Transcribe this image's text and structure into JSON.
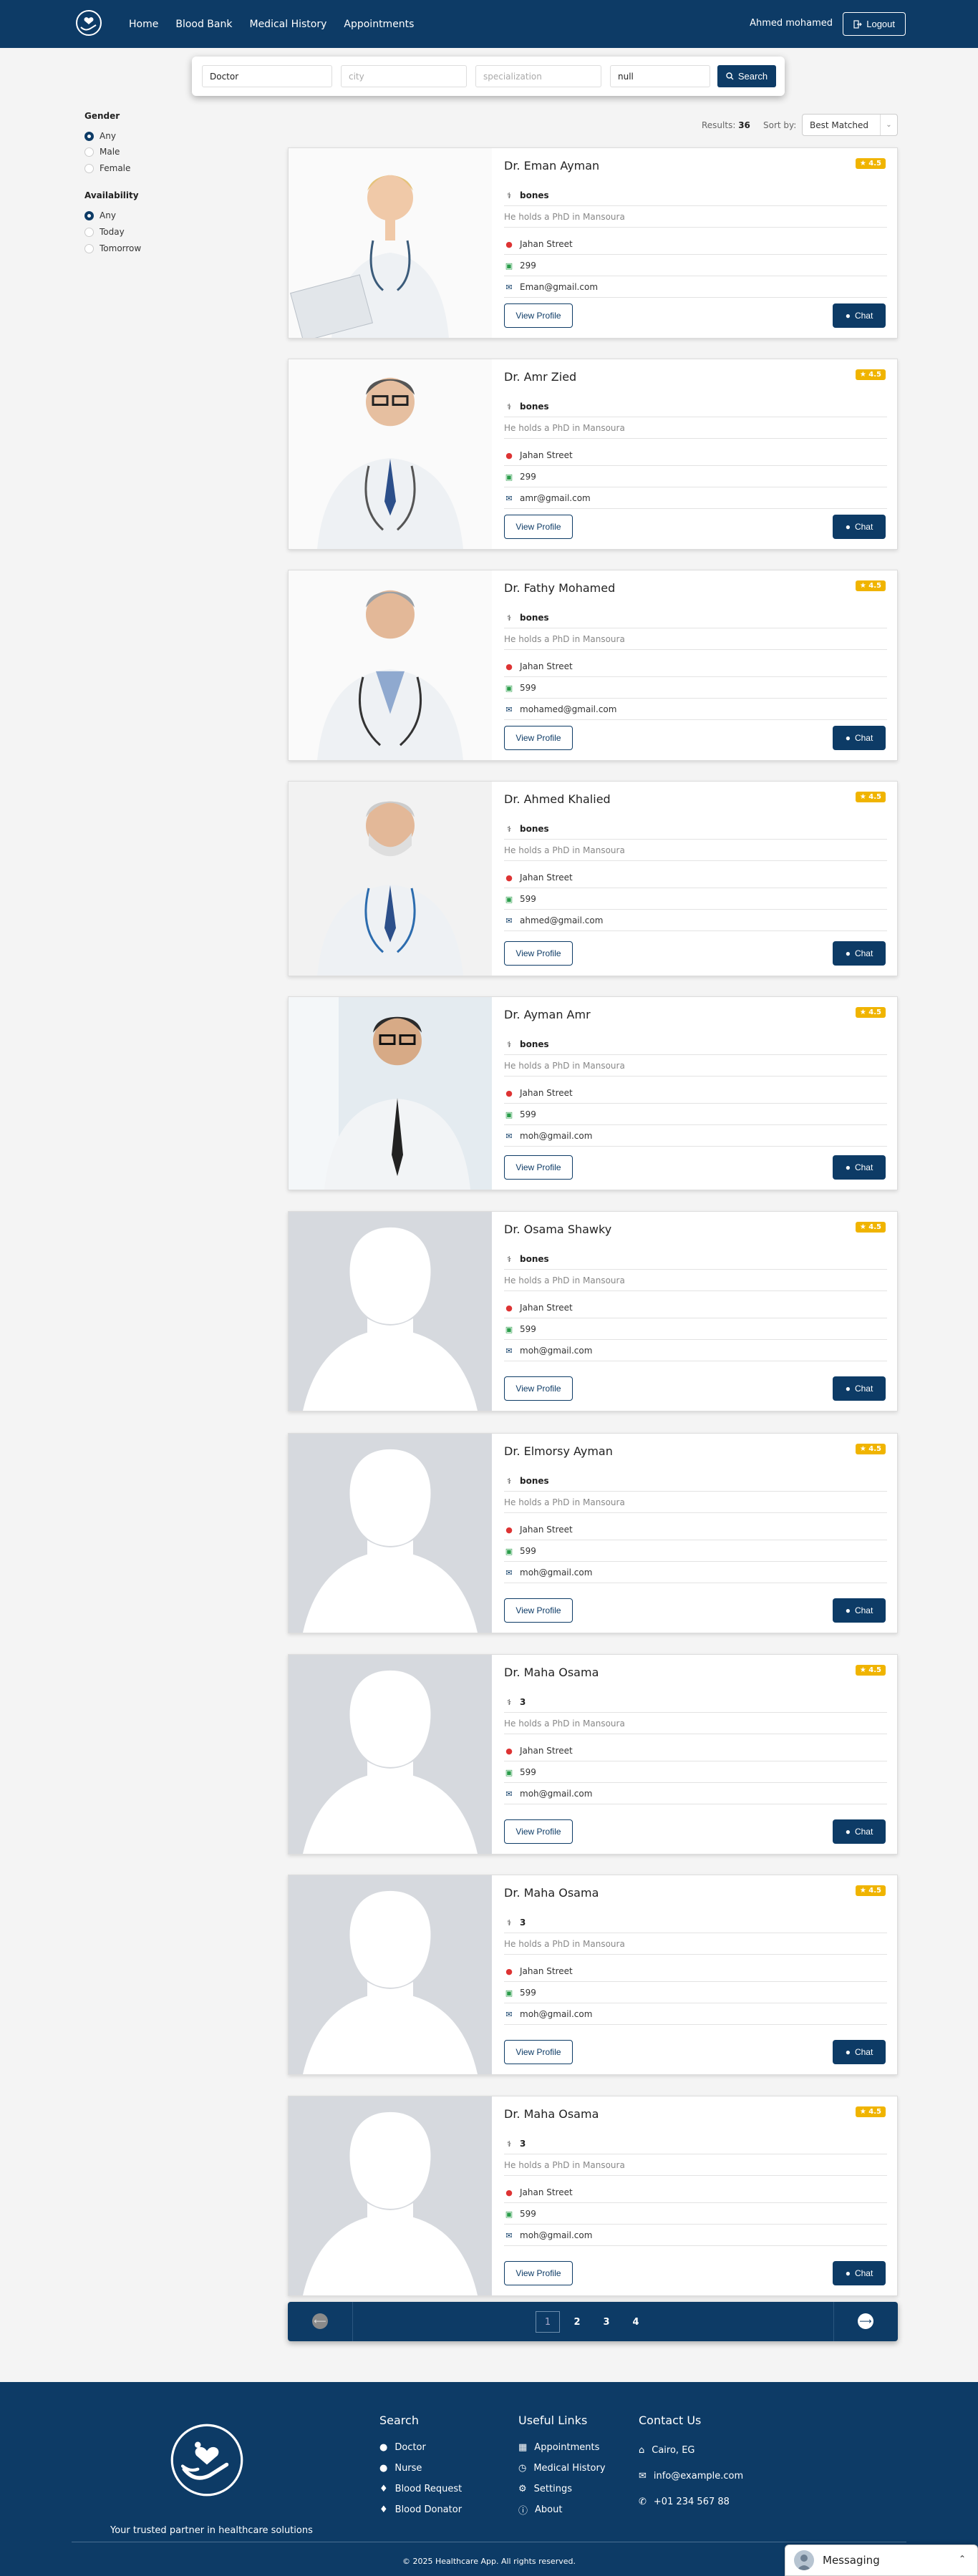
{
  "nav": {
    "links": [
      "Home",
      "Blood Bank",
      "Medical History",
      "Appointments"
    ],
    "user": "Ahmed mohamed",
    "logout": "Logout"
  },
  "search": {
    "profession_value": "Doctor",
    "city_placeholder": "city",
    "specialization_placeholder": "specialization",
    "name_value": "null",
    "button": "Search"
  },
  "filters": {
    "gender_title": "Gender",
    "gender_options": [
      "Any",
      "Male",
      "Female"
    ],
    "gender_selected": "Any",
    "availability_title": "Availability",
    "availability_options": [
      "Any",
      "Today",
      "Tomorrow"
    ],
    "availability_selected": "Any"
  },
  "results": {
    "label": "Results:",
    "count": "36",
    "sort_label": "Sort by:",
    "sort_value": "Best Matched"
  },
  "doctors": [
    {
      "name": "Dr. Eman Ayman",
      "rating": "4.5",
      "specialty": "bones",
      "about": "He holds a PhD in Mansoura",
      "address": "Jahan Street",
      "price": "299",
      "email": "Eman@gmail.com",
      "view": "View Profile",
      "chat": "Chat",
      "photo": "female-doctor-clipboard"
    },
    {
      "name": "Dr. Amr Zied",
      "rating": "4.5",
      "specialty": "bones",
      "about": "He holds a PhD in Mansoura",
      "address": "Jahan Street",
      "price": "299",
      "email": "amr@gmail.com",
      "view": "View Profile",
      "chat": "Chat",
      "photo": "male-doctor-glasses"
    },
    {
      "name": "Dr. Fathy Mohamed",
      "rating": "4.5",
      "specialty": "bones",
      "about": "He holds a PhD in Mansoura",
      "address": "Jahan Street",
      "price": "599",
      "email": "mohamed@gmail.com",
      "view": "View Profile",
      "chat": "Chat",
      "photo": "senior-male-doctor"
    },
    {
      "name": "Dr. Ahmed Khalied",
      "rating": "4.5",
      "specialty": "bones",
      "about": "He holds a PhD in Mansoura",
      "address": "Jahan Street",
      "price": "599",
      "email": "ahmed@gmail.com",
      "view": "View Profile",
      "chat": "Chat",
      "photo": "bearded-male-doctor"
    },
    {
      "name": "Dr. Ayman Amr",
      "rating": "4.5",
      "specialty": "bones",
      "about": "He holds a PhD in Mansoura",
      "address": "Jahan Street",
      "price": "599",
      "email": "moh@gmail.com",
      "view": "View Profile",
      "chat": "Chat",
      "photo": "young-male-doctor"
    },
    {
      "name": "Dr. Osama Shawky",
      "rating": "4.5",
      "specialty": "bones",
      "about": "He holds a PhD in Mansoura",
      "address": "Jahan Street",
      "price": "599",
      "email": "moh@gmail.com",
      "view": "View Profile",
      "chat": "Chat",
      "photo": "placeholder"
    },
    {
      "name": "Dr. Elmorsy Ayman",
      "rating": "4.5",
      "specialty": "bones",
      "about": "He holds a PhD in Mansoura",
      "address": "Jahan Street",
      "price": "599",
      "email": "moh@gmail.com",
      "view": "View Profile",
      "chat": "Chat",
      "photo": "placeholder"
    },
    {
      "name": "Dr. Maha Osama",
      "rating": "4.5",
      "specialty": "3",
      "about": "He holds a PhD in Mansoura",
      "address": "Jahan Street",
      "price": "599",
      "email": "moh@gmail.com",
      "view": "View Profile",
      "chat": "Chat",
      "photo": "placeholder"
    },
    {
      "name": "Dr. Maha Osama",
      "rating": "4.5",
      "specialty": "3",
      "about": "He holds a PhD in Mansoura",
      "address": "Jahan Street",
      "price": "599",
      "email": "moh@gmail.com",
      "view": "View Profile",
      "chat": "Chat",
      "photo": "placeholder"
    },
    {
      "name": "Dr. Maha Osama",
      "rating": "4.5",
      "specialty": "3",
      "about": "He holds a PhD in Mansoura",
      "address": "Jahan Street",
      "price": "599",
      "email": "moh@gmail.com",
      "view": "View Profile",
      "chat": "Chat",
      "photo": "placeholder"
    }
  ],
  "pagination": {
    "pages": [
      "1",
      "2",
      "3",
      "4"
    ],
    "current": "1"
  },
  "footer": {
    "tagline": "Your trusted partner in healthcare solutions",
    "search_title": "Search",
    "search_links": [
      "Doctor",
      "Nurse",
      "Blood Request",
      "Blood Donator"
    ],
    "useful_title": "Useful Links",
    "useful_links": [
      "Appointments",
      "Medical History",
      "Settings",
      "About"
    ],
    "contact_title": "Contact Us",
    "contact": [
      "Cairo, EG",
      "info@example.com",
      "+01 234 567 88"
    ],
    "copyright": "© 2025 Healthcare App. All rights reserved."
  },
  "messaging": {
    "label": "Messaging"
  },
  "colors": {
    "primary": "#0d3b66",
    "rating_badge": "#f0b400",
    "background": "#f4f4f4"
  }
}
